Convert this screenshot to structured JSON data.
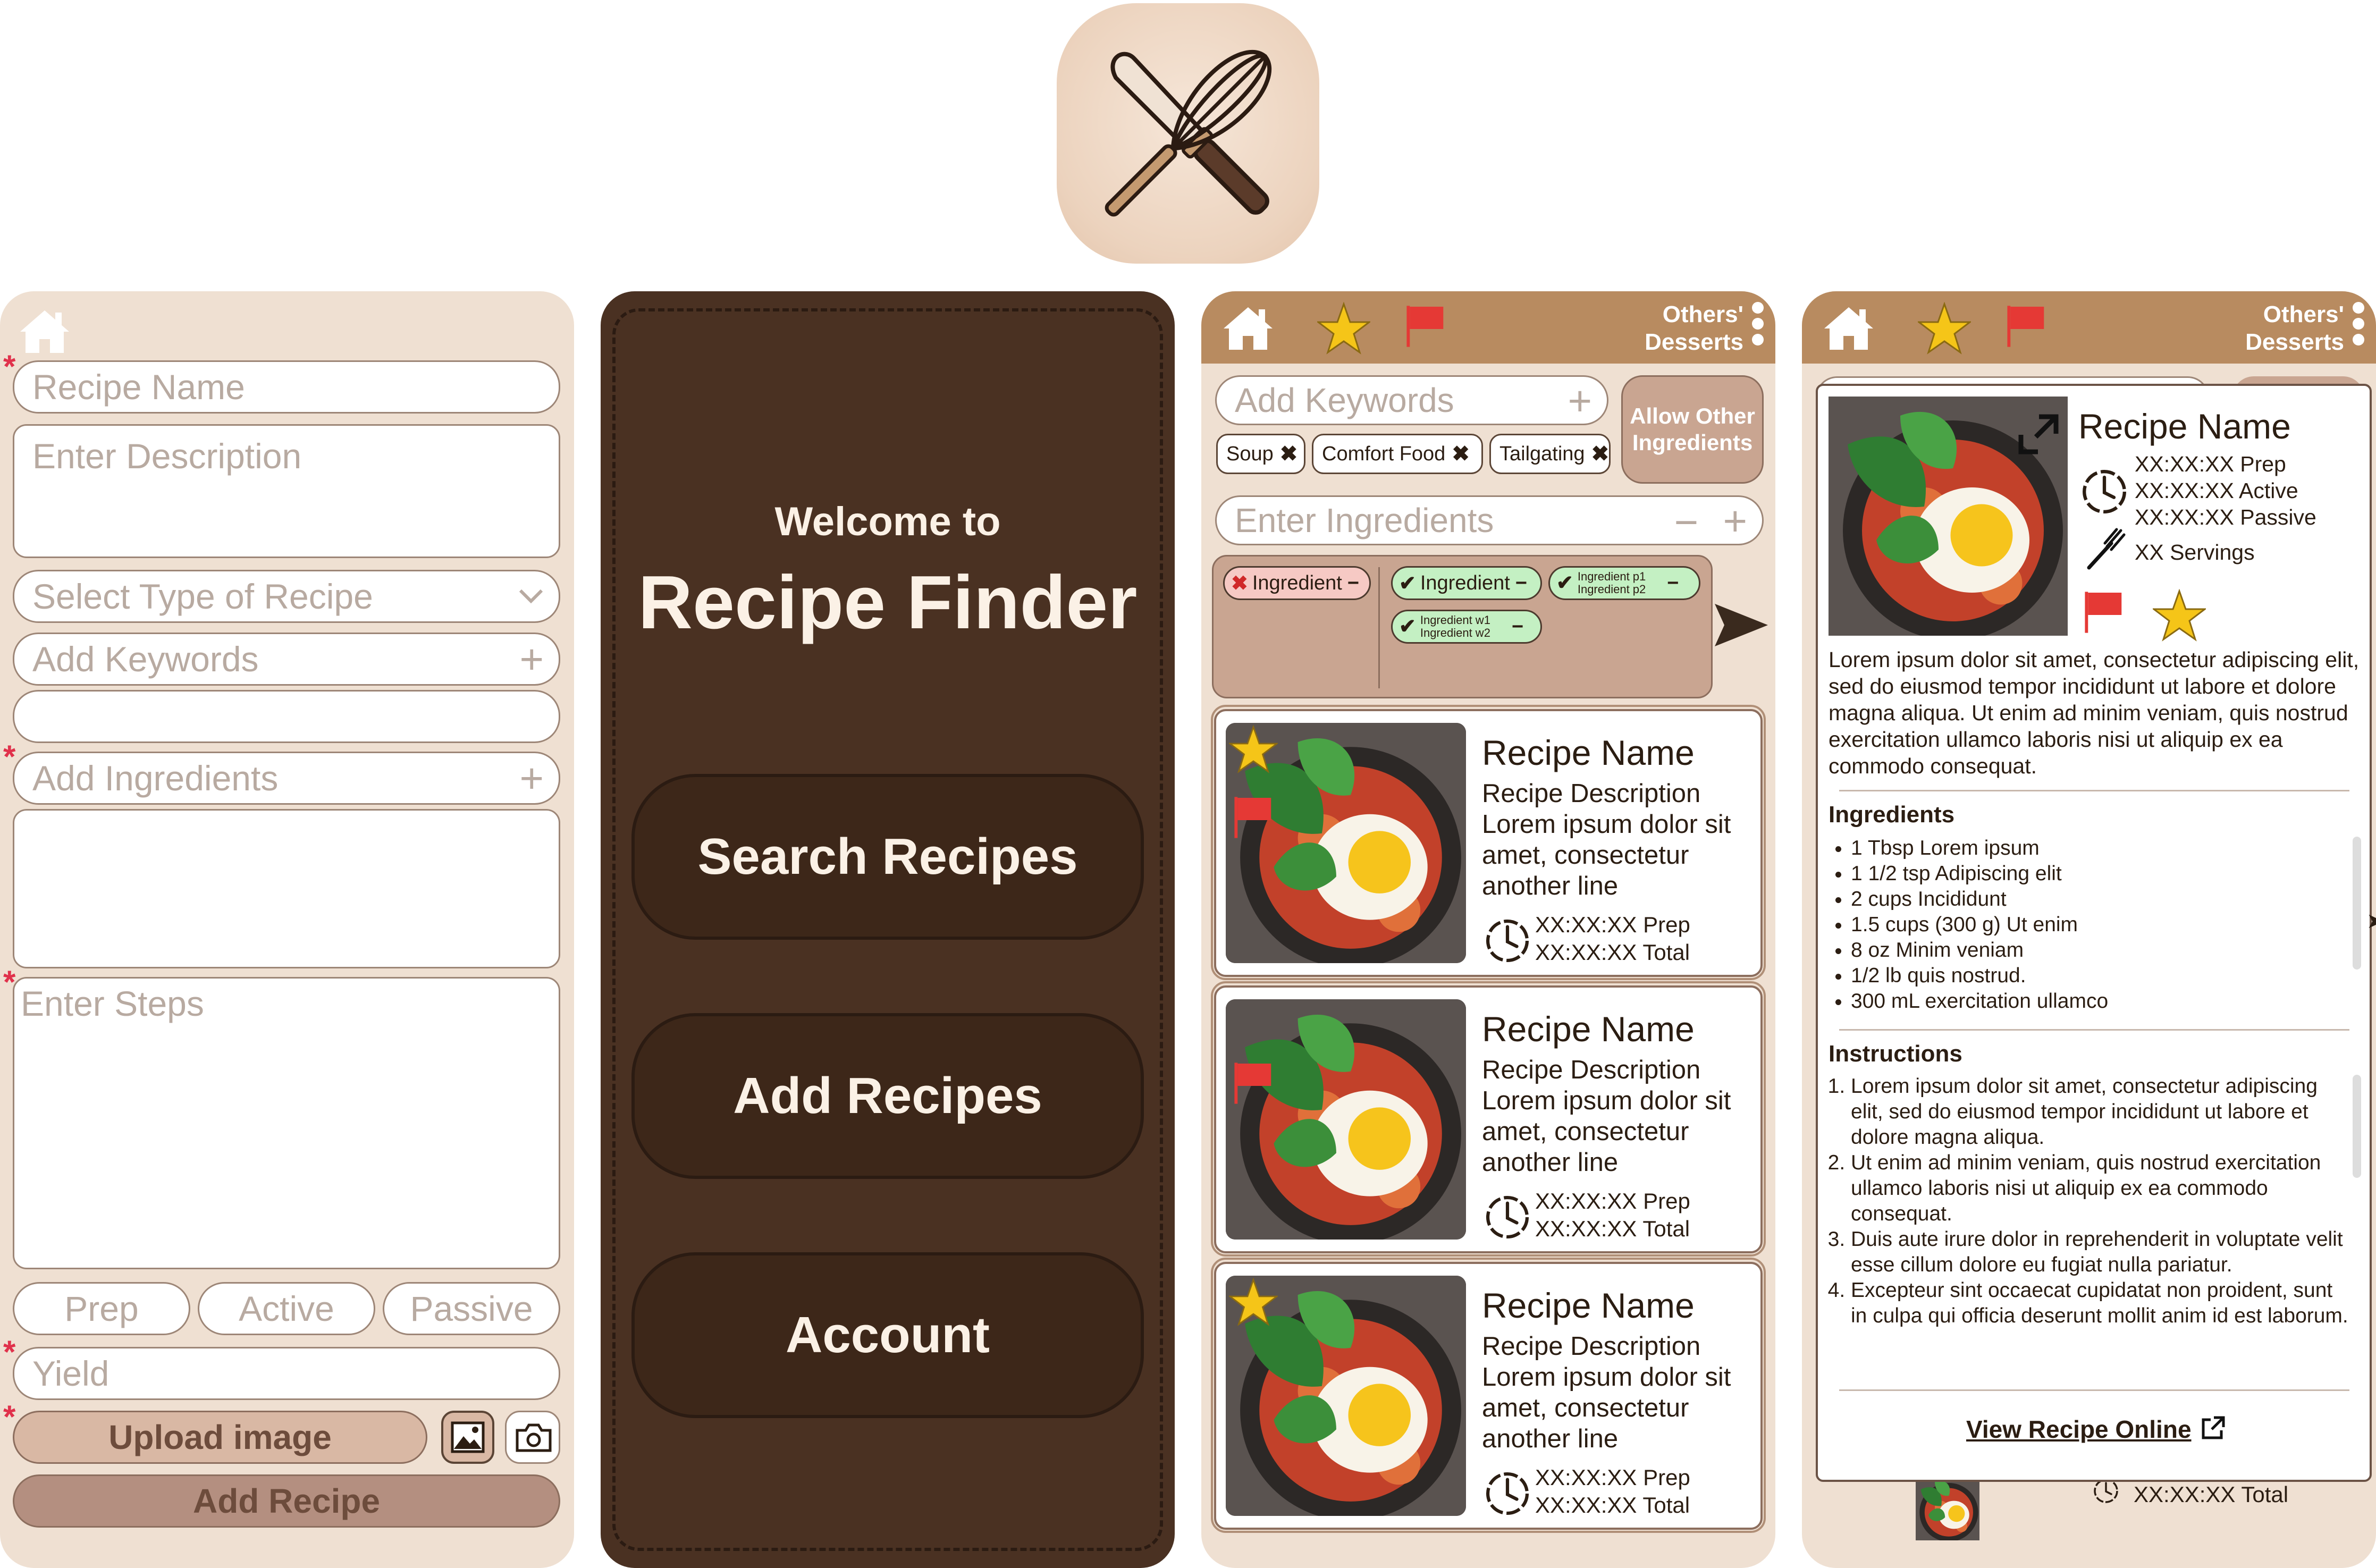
{
  "app": {
    "name": "Recipe Finder"
  },
  "add_recipe_form": {
    "recipe_name_placeholder": "Recipe Name",
    "description_placeholder": "Enter Description",
    "type_placeholder": "Select Type of Recipe",
    "keywords_placeholder": "Add Keywords",
    "ingredients_placeholder": "Add Ingredients",
    "steps_placeholder": "Enter Steps",
    "prep_placeholder": "Prep",
    "active_placeholder": "Active",
    "passive_placeholder": "Passive",
    "yield_placeholder": "Yield",
    "upload_label": "Upload image",
    "submit_label": "Add Recipe",
    "required_mark": "*",
    "plus_symbol": "+"
  },
  "welcome": {
    "greeting": "Welcome to",
    "title": "Recipe Finder",
    "buttons": [
      "Search Recipes",
      "Add Recipes",
      "Account"
    ]
  },
  "topbar": {
    "label_line1": "Others'",
    "label_line2": "Desserts"
  },
  "search": {
    "keywords_placeholder": "Add Keywords",
    "allow_other_label": "Allow Other Ingredients",
    "keyword_chips": [
      "Soup",
      "Comfort Food",
      "Tailgating"
    ],
    "ingredients_placeholder": "Enter Ingredients",
    "excluded_ingredient": "Ingredient",
    "included_ingredient": "Ingredient",
    "alt_pair_1": [
      "Ingredient p1",
      "Ingredient p2"
    ],
    "alt_pair_2": [
      "Ingredient w1",
      "Ingredient w2"
    ]
  },
  "results": [
    {
      "title": "Recipe Name",
      "desc_head": "Recipe Description",
      "desc": "Lorem ipsum dolor sit amet, consectetur another line",
      "prep": "XX:XX:XX Prep",
      "total": "XX:XX:XX Total",
      "starred": true,
      "flagged": true
    },
    {
      "title": "Recipe Name",
      "desc_head": "Recipe Description",
      "desc": "Lorem ipsum dolor sit amet, consectetur another line",
      "prep": "XX:XX:XX Prep",
      "total": "XX:XX:XX Total",
      "starred": false,
      "flagged": true
    },
    {
      "title": "Recipe Name",
      "desc_head": "Recipe Description",
      "desc": "Lorem ipsum dolor sit amet, consectetur another line",
      "prep": "XX:XX:XX Prep",
      "total": "XX:XX:XX Total",
      "starred": true,
      "flagged": false
    }
  ],
  "detail": {
    "title": "Recipe Name",
    "prep": "XX:XX:XX Prep",
    "active": "XX:XX:XX Active",
    "passive": "XX:XX:XX Passive",
    "servings": "XX Servings",
    "summary": "Lorem ipsum dolor sit amet, consectetur adipiscing elit, sed do eiusmod tempor incididunt ut labore et dolore magna aliqua. Ut enim ad minim veniam, quis nostrud exercitation ullamco laboris nisi ut aliquip ex ea commodo consequat.",
    "ingredients_heading": "Ingredients",
    "ingredients": [
      "1 Tbsp Lorem ipsum",
      "1 1/2 tsp Adipiscing elit",
      "2 cups Incididunt",
      "1.5 cups (300 g) Ut enim",
      "8 oz Minim veniam",
      "1/2 lb quis nostrud.",
      "300 mL exercitation ullamco"
    ],
    "instructions_heading": "Instructions",
    "instructions": [
      "Lorem ipsum dolor sit amet, consectetur adipiscing elit, sed do eiusmod tempor incididunt ut labore et dolore magna aliqua.",
      "Ut enim ad minim veniam, quis nostrud exercitation ullamco laboris nisi ut aliquip ex ea commodo consequat.",
      "Duis aute irure dolor in reprehenderit in voluptate velit esse cillum dolore eu fugiat nulla pariatur.",
      "Excepteur sint occaecat cupidatat non proident, sunt in culpa qui officia deserunt mollit anim id est laborum."
    ],
    "view_online_label": "View Recipe Online",
    "behind_total": "XX:XX:XX Total"
  },
  "colors": {
    "header": "#b88b60",
    "panel": "#efe0d2",
    "dark": "#4a3122",
    "required": "#e0314b",
    "star": "#f5c518",
    "flag": "#e53935"
  }
}
